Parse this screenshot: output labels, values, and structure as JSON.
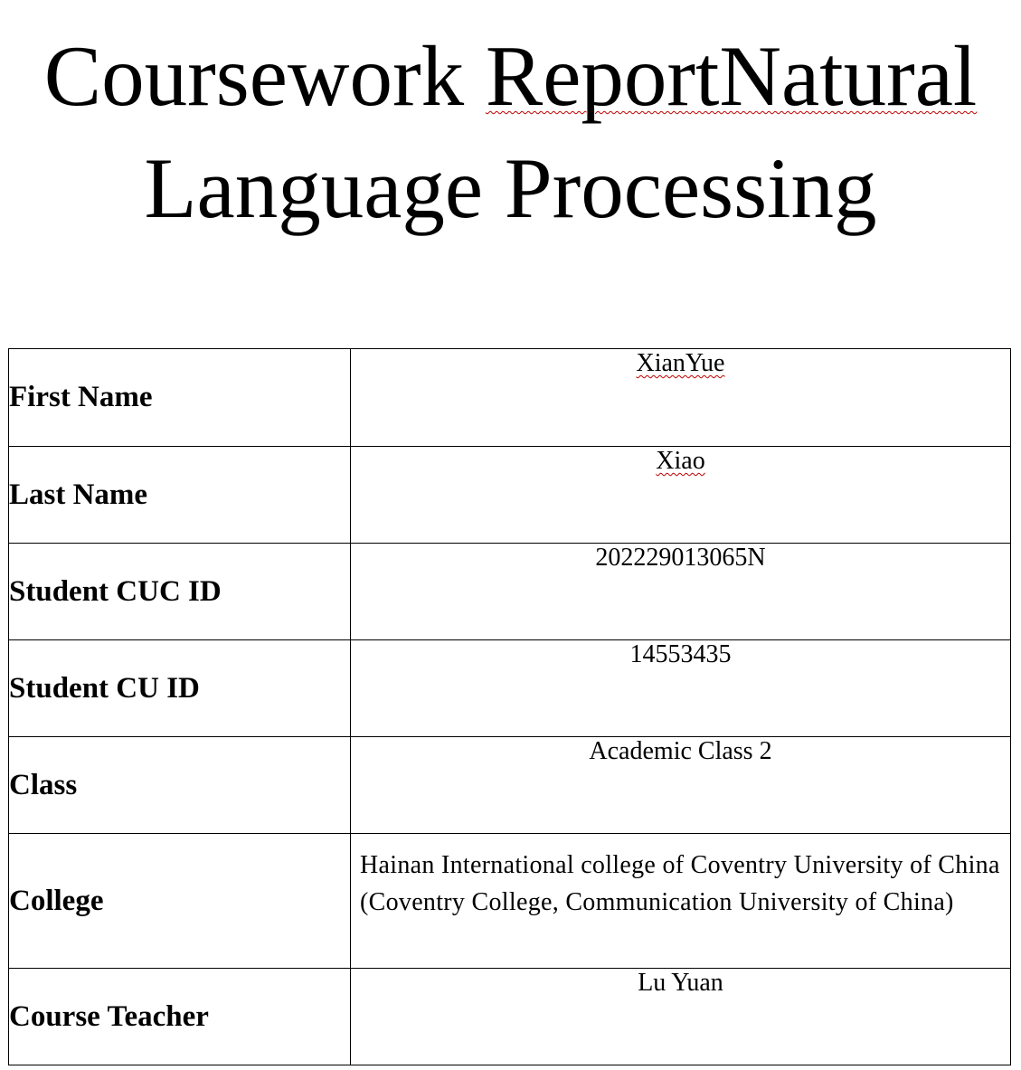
{
  "document": {
    "title_part1": "Coursework ",
    "title_part2": "ReportNatural",
    "title_line2": "Language Processing"
  },
  "info_table": {
    "rows": [
      {
        "label": "First Name",
        "value": "XianYue"
      },
      {
        "label": "Last Name",
        "value": "Xiao"
      },
      {
        "label": "Student CUC ID",
        "value": "202229013065N"
      },
      {
        "label": "Student CU ID",
        "value": "14553435"
      },
      {
        "label": "Class",
        "value": "Academic Class 2"
      },
      {
        "label": "College",
        "value": "Hainan International college of Coventry University of China (Coventry College, Communication University of China)"
      },
      {
        "label": "Course Teacher",
        "value": "Lu Yuan"
      }
    ]
  },
  "colors": {
    "text": "#000000",
    "background": "#ffffff",
    "spellcheck_underline": "#c00000",
    "border": "#000000"
  }
}
